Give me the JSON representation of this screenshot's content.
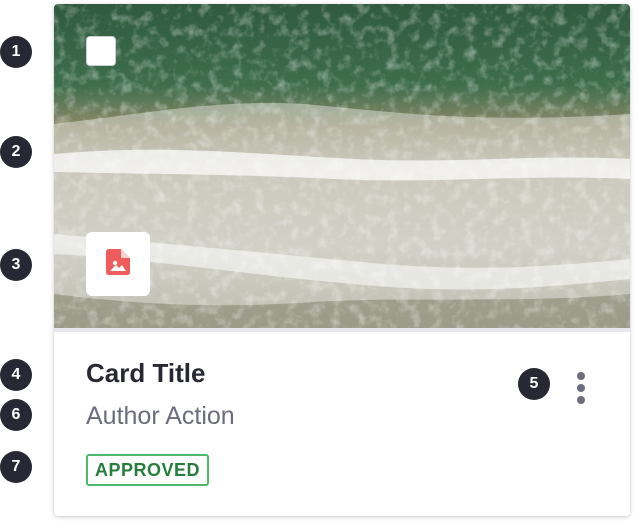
{
  "markers": [
    "1",
    "2",
    "3",
    "4",
    "5",
    "6",
    "7"
  ],
  "card": {
    "title": "Card Title",
    "subtitle": "Author Action",
    "status_label": "APPROVED",
    "image_icon": "image-file-icon",
    "menu_icon": "ellipsis-vertical-icon"
  },
  "colors": {
    "marker_bg": "#272833",
    "title": "#272833",
    "subtitle": "#6b6c7e",
    "status_text": "#287d3c",
    "status_border": "#4dba6b",
    "file_icon": "#f05b5b",
    "kebab": "#6b6c7e"
  }
}
